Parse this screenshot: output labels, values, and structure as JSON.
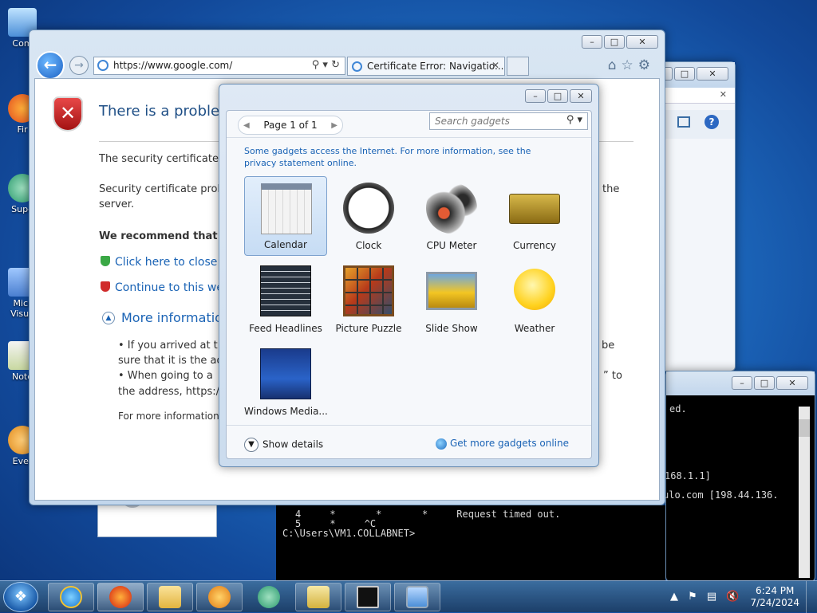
{
  "desktop": {
    "icons": [
      {
        "label": "Com"
      },
      {
        "label": "Fir"
      },
      {
        "label": "Supe"
      },
      {
        "label": "Micr Visua"
      },
      {
        "label": "Note"
      },
      {
        "label": "Ever"
      }
    ]
  },
  "ie": {
    "address": "https://www.google.com/",
    "tab_title": "Certificate Error: Navigatio...",
    "page": {
      "title": "There is a problem",
      "line1": "The security certificate p",
      "line2a": "Security certificate prob",
      "line2b": "server.",
      "line2c": "the",
      "recommend": "We recommend that y",
      "close_link": "Click here to close th",
      "continue_link": "Continue to this web",
      "more_info": "More information",
      "bullet1a": "•   If you arrived at t",
      "bullet1b": "sure that it is the ad",
      "bullet1c": "be",
      "bullet2a": "•   When going to a",
      "bullet2b": "the address, https:/",
      "bullet2c": "” to",
      "footer": "For more information,"
    }
  },
  "cmd": {
    "line_top": "ed.",
    "line_ip": "168.1.1]",
    "line_host": "ulo.com [198.44.136.",
    "line_r1": "4     *       *       *     Request timed out.",
    "line_r2": "5     *     ^C",
    "prompt": "C:\\Users\\VM1.COLLABNET>"
  },
  "gadgets": {
    "pager": "Page 1 of 1",
    "search_placeholder": "Search gadgets",
    "note": "Some gadgets access the Internet.  For more information, see the privacy statement online.",
    "items": [
      {
        "name": "Calendar"
      },
      {
        "name": "Clock"
      },
      {
        "name": "CPU Meter"
      },
      {
        "name": "Currency"
      },
      {
        "name": "Feed Headlines"
      },
      {
        "name": "Picture Puzzle"
      },
      {
        "name": "Slide Show"
      },
      {
        "name": "Weather"
      },
      {
        "name": "Windows Media..."
      }
    ],
    "show_details": "Show details",
    "more_online": "Get more gadgets online"
  },
  "taskbar": {
    "time": "6:24 PM",
    "date": "7/24/2024"
  }
}
